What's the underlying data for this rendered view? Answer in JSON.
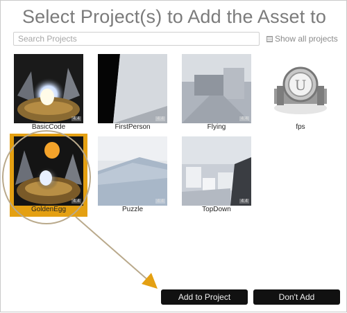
{
  "dialog": {
    "title": "Select Project(s) to Add the Asset to"
  },
  "search": {
    "placeholder": "Search Projects",
    "value": ""
  },
  "show_all": {
    "label": "Show all projects",
    "checked": false
  },
  "projects": [
    {
      "name": "BasicCode",
      "version": "4.4",
      "selected": false
    },
    {
      "name": "FirstPerson",
      "version": "4.4",
      "selected": false
    },
    {
      "name": "Flying",
      "version": "4.4",
      "selected": false
    },
    {
      "name": "fps",
      "version": "",
      "selected": false
    },
    {
      "name": "GoldenEgg",
      "version": "4.4",
      "selected": true
    },
    {
      "name": "Puzzle",
      "version": "4.4",
      "selected": false
    },
    {
      "name": "TopDown",
      "version": "4.4",
      "selected": false
    }
  ],
  "buttons": {
    "add": "Add to Project",
    "dont_add": "Don't Add"
  },
  "colors": {
    "selection": "#e4a012",
    "annotation": "#b9a98b",
    "button_bg": "#111111"
  }
}
